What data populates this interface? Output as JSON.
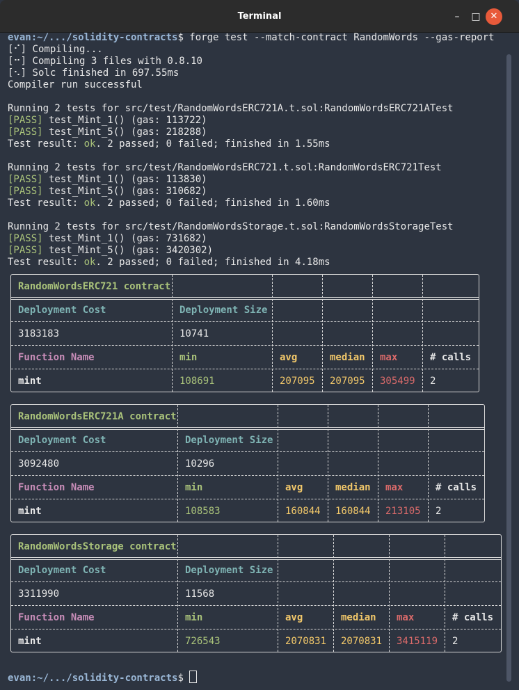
{
  "window": {
    "title": "Terminal"
  },
  "prompt": {
    "user": "evan",
    "path": ":~/.../solidity-contracts",
    "symbol": "$ "
  },
  "command": "forge test --match-contract RandomWords --gas-report",
  "compile": [
    {
      "spinner": "[⠊]",
      "text": " Compiling..."
    },
    {
      "spinner": "[⠒]",
      "text": " Compiling 3 files with 0.8.10"
    },
    {
      "spinner": "[⠢]",
      "text": " Solc finished in 697.55ms"
    }
  ],
  "compile_done": "Compiler run successful",
  "suites": [
    {
      "header": "Running 2 tests for src/test/RandomWordsERC721A.t.sol:RandomWordsERC721ATest",
      "tests": [
        {
          "tag": "[PASS]",
          "text": " test_Mint_1() (gas: 113722)"
        },
        {
          "tag": "[PASS]",
          "text": " test_Mint_5() (gas: 218288)"
        }
      ],
      "result_pre": "Test result: ",
      "result_ok": "ok",
      "result_post": ". 2 passed; 0 failed; finished in 1.55ms"
    },
    {
      "header": "Running 2 tests for src/test/RandomWordsERC721.t.sol:RandomWordsERC721Test",
      "tests": [
        {
          "tag": "[PASS]",
          "text": " test_Mint_1() (gas: 113830)"
        },
        {
          "tag": "[PASS]",
          "text": " test_Mint_5() (gas: 310682)"
        }
      ],
      "result_pre": "Test result: ",
      "result_ok": "ok",
      "result_post": ". 2 passed; 0 failed; finished in 1.60ms"
    },
    {
      "header": "Running 2 tests for src/test/RandomWordsStorage.t.sol:RandomWordsStorageTest",
      "tests": [
        {
          "tag": "[PASS]",
          "text": " test_Mint_1() (gas: 731682)"
        },
        {
          "tag": "[PASS]",
          "text": " test_Mint_5() (gas: 3420302)"
        }
      ],
      "result_pre": "Test result: ",
      "result_ok": "ok",
      "result_post": ". 2 passed; 0 failed; finished in 4.18ms"
    }
  ],
  "reports": [
    {
      "contract": "RandomWordsERC721 contract",
      "dep_cost_label": "Deployment Cost",
      "dep_size_label": "Deployment Size",
      "dep_cost": "3183183",
      "dep_size": "10741",
      "headers": [
        "Function Name",
        "min",
        "avg",
        "median",
        "max",
        "# calls"
      ],
      "row": [
        "mint",
        "108691",
        "207095",
        "207095",
        "305499",
        "2"
      ]
    },
    {
      "contract": "RandomWordsERC721A contract",
      "dep_cost_label": "Deployment Cost",
      "dep_size_label": "Deployment Size",
      "dep_cost": "3092480",
      "dep_size": "10296",
      "headers": [
        "Function Name",
        "min",
        "avg",
        "median",
        "max",
        "# calls"
      ],
      "row": [
        "mint",
        "108583",
        "160844",
        "160844",
        "213105",
        "2"
      ]
    },
    {
      "contract": "RandomWordsStorage contract",
      "dep_cost_label": "Deployment Cost",
      "dep_size_label": "Deployment Size",
      "dep_cost": "3311990",
      "dep_size": "11568",
      "headers": [
        "Function Name",
        "min",
        "avg",
        "median",
        "max",
        "# calls"
      ],
      "row": [
        "mint",
        "726543",
        "2070831",
        "2070831",
        "3415119",
        "2"
      ]
    }
  ]
}
